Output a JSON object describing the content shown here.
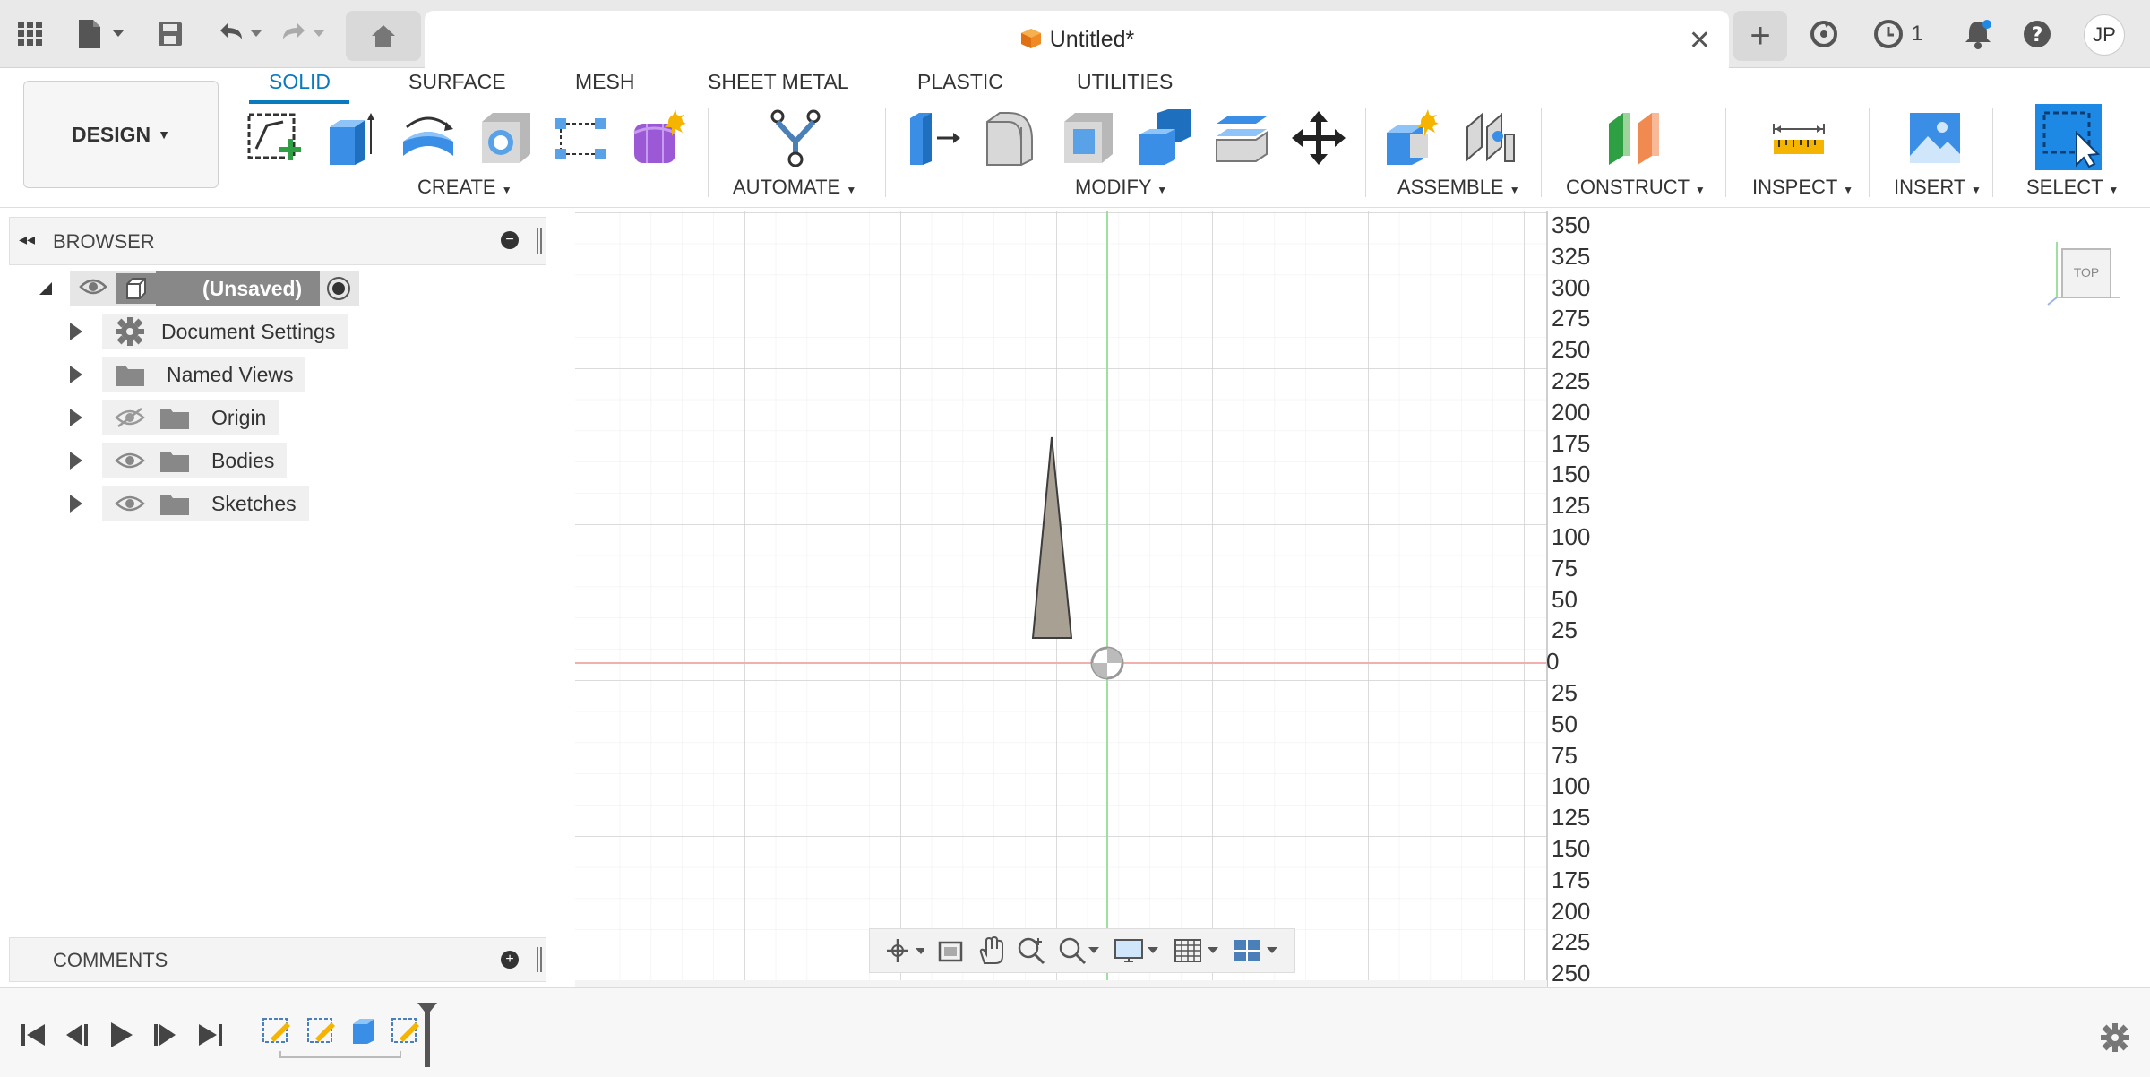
{
  "app": {
    "document_title": "Untitled*",
    "jobs_count": "1",
    "user_initials": "JP"
  },
  "toolbar": {
    "workspace_label": "DESIGN",
    "tabs": [
      "SOLID",
      "SURFACE",
      "MESH",
      "SHEET METAL",
      "PLASTIC",
      "UTILITIES"
    ],
    "active_tab": "SOLID",
    "groups": {
      "create": "CREATE",
      "automate": "AUTOMATE",
      "modify": "MODIFY",
      "assemble": "ASSEMBLE",
      "construct": "CONSTRUCT",
      "inspect": "INSPECT",
      "insert": "INSERT",
      "select": "SELECT"
    }
  },
  "browser": {
    "title": "BROWSER",
    "root_label": "(Unsaved)",
    "items": [
      {
        "label": "Document Settings",
        "icon": "gear-icon",
        "visibility": "none"
      },
      {
        "label": "Named Views",
        "icon": "folder-icon",
        "visibility": "none"
      },
      {
        "label": "Origin",
        "icon": "folder-icon",
        "visibility": "hidden"
      },
      {
        "label": "Bodies",
        "icon": "folder-icon",
        "visibility": "visible"
      },
      {
        "label": "Sketches",
        "icon": "folder-icon",
        "visibility": "visible"
      }
    ]
  },
  "comments": {
    "title": "COMMENTS"
  },
  "viewport": {
    "ruler_positive": [
      "350",
      "325",
      "300",
      "275",
      "250",
      "225",
      "200",
      "175",
      "150",
      "125",
      "100",
      "75",
      "50",
      "25",
      "0"
    ],
    "ruler_negative": [
      "25",
      "50",
      "75",
      "100",
      "125",
      "150",
      "175",
      "200",
      "225",
      "250"
    ],
    "view_cube_label": "TOP"
  },
  "colors": {
    "accent": "#0a7abf",
    "axis_x": "#f1b0b0",
    "axis_y": "#9ee09e",
    "body_fill": "#a8a193"
  }
}
